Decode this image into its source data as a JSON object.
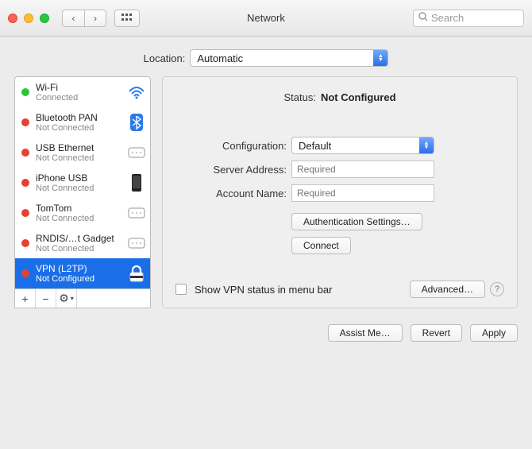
{
  "window": {
    "title": "Network"
  },
  "search": {
    "placeholder": "Search"
  },
  "location": {
    "label": "Location:",
    "value": "Automatic"
  },
  "sidebar": {
    "items": [
      {
        "name": "Wi-Fi",
        "sub": "Connected",
        "status": "green",
        "icon": "wifi"
      },
      {
        "name": "Bluetooth PAN",
        "sub": "Not Connected",
        "status": "red",
        "icon": "bluetooth"
      },
      {
        "name": "USB Ethernet",
        "sub": "Not Connected",
        "status": "red",
        "icon": "ethernet"
      },
      {
        "name": "iPhone USB",
        "sub": "Not Connected",
        "status": "red",
        "icon": "phone"
      },
      {
        "name": "TomTom",
        "sub": "Not Connected",
        "status": "red",
        "icon": "ethernet"
      },
      {
        "name": "RNDIS/…t Gadget",
        "sub": "Not Connected",
        "status": "red",
        "icon": "ethernet"
      },
      {
        "name": "VPN (L2TP)",
        "sub": "Not Configured",
        "status": "red",
        "icon": "vpn",
        "selected": true
      }
    ],
    "add": "+",
    "remove": "−",
    "gear": "⚙︎"
  },
  "detail": {
    "status_label": "Status:",
    "status_value": "Not Configured",
    "config_label": "Configuration:",
    "config_value": "Default",
    "server_label": "Server Address:",
    "server_placeholder": "Required",
    "account_label": "Account Name:",
    "account_placeholder": "Required",
    "auth_button": "Authentication Settings…",
    "connect_button": "Connect",
    "show_vpn_label": "Show VPN status in menu bar",
    "advanced_button": "Advanced…"
  },
  "footer": {
    "assist": "Assist Me…",
    "revert": "Revert",
    "apply": "Apply"
  }
}
